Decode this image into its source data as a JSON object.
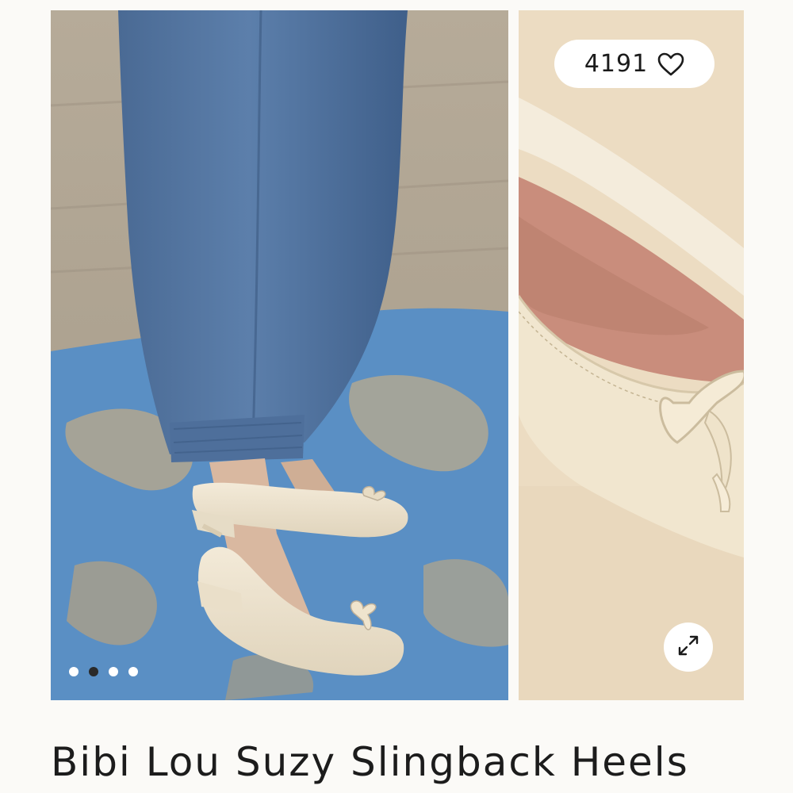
{
  "gallery": {
    "main_image_alt": "Model wearing cream slingback heels with blue trousers",
    "side_image_alt": "Close-up of cream slingback heel with bow",
    "dots": [
      {
        "active": false
      },
      {
        "active": true
      },
      {
        "active": false
      },
      {
        "active": false
      }
    ]
  },
  "likes": {
    "count": "4191",
    "icon": "heart-icon"
  },
  "expand": {
    "icon": "expand-icon"
  },
  "product": {
    "title": "Bibi Lou Suzy Slingback Heels"
  }
}
